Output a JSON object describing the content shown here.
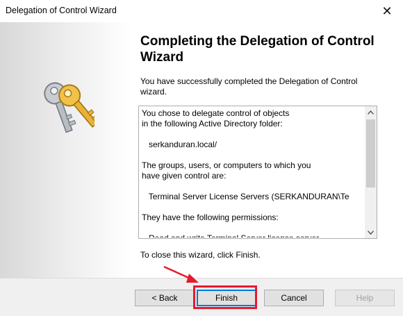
{
  "window": {
    "title": "Delegation of Control Wizard",
    "close_glyph": "✕"
  },
  "wizard": {
    "heading": "Completing the Delegation of Control Wizard",
    "intro": "You have successfully completed the Delegation of Control wizard.",
    "summary_lines": [
      "You chose to delegate control of objects",
      "in the following Active Directory folder:",
      "",
      "   serkanduran.local/",
      "",
      "The groups, users, or computers to which you",
      "have given control are:",
      "",
      "   Terminal Server License Servers (SERKANDURAN\\Te",
      "",
      "They have the following permissions:",
      "",
      "   Read and write Terminal Server license server"
    ],
    "close_hint": "To close this wizard, click Finish."
  },
  "buttons": {
    "back": "< Back",
    "finish": "Finish",
    "cancel": "Cancel",
    "help": "Help"
  },
  "icons": {
    "keys": "keys-icon",
    "scroll_up": "scroll-up-arrow-icon",
    "scroll_down": "scroll-down-arrow-icon"
  },
  "colors": {
    "highlight": "#e8192c",
    "focus": "#0078d7"
  }
}
